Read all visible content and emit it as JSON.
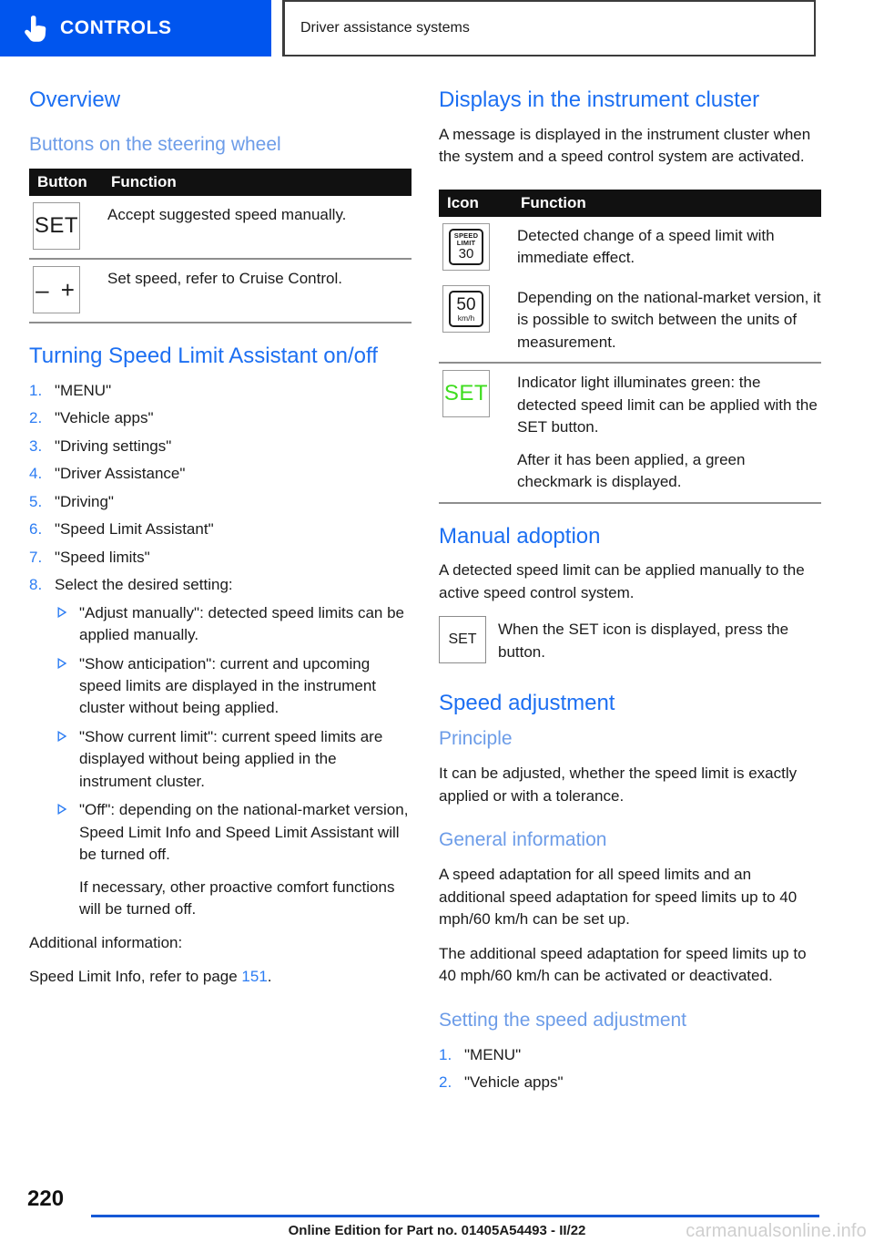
{
  "header": {
    "tab_label": "CONTROLS",
    "hand_icon": "pointing-hand-icon",
    "breadcrumb": "Driver assistance systems",
    "accent_blue": "#0055ee"
  },
  "left": {
    "overview_heading": "Overview",
    "buttons_subheading": "Buttons on the steering wheel",
    "buttons_table": {
      "headers": [
        "Button",
        "Function"
      ],
      "rows": [
        {
          "icon": "SET",
          "icon_kind": "set-button-icon",
          "function": "Accept suggested speed manually."
        },
        {
          "icon": "– +",
          "icon_kind": "minus-plus-rocker-icon",
          "function": "Set speed, refer to Cruise Control."
        }
      ]
    },
    "turning_heading": "Turning Speed Limit Assistant on/off",
    "steps": [
      "\"MENU\"",
      "\"Vehicle apps\"",
      "\"Driving settings\"",
      "\"Driver Assistance\"",
      "\"Driving\"",
      "\"Speed Limit Assistant\"",
      "\"Speed limits\"",
      "Select the desired setting:"
    ],
    "options": [
      {
        "para1": "\"Adjust manually\": detected speed limits can be applied manually."
      },
      {
        "para1": "\"Show anticipation\": current and upcoming speed limits are displayed in the instrument cluster without being applied."
      },
      {
        "para1": "\"Show current limit\": current speed limits are displayed without being applied in the instrument cluster."
      },
      {
        "para1": "\"Off\": depending on the national-market version, Speed Limit Info and Speed Limit Assistant will be turned off.",
        "para2": "If necessary, other proactive comfort functions will be turned off."
      }
    ],
    "additional_label": "Additional information:",
    "xref_prefix": "Speed Limit Info, refer to page ",
    "xref_page": "151",
    "xref_suffix": "."
  },
  "right": {
    "displays_heading": "Displays in the instrument cluster",
    "displays_intro": "A message is displayed in the instrument cluster when the system and a speed control system are activated.",
    "icon_table": {
      "headers": [
        "Icon",
        "Function"
      ],
      "rows": [
        {
          "icon_kind": "speed-limit-30-sign-icon",
          "sign_top": "SPEED",
          "sign_top2": "LIMIT",
          "sign_value": "30",
          "sign_unit": "",
          "function": "Detected change of a speed limit with immediate effect."
        },
        {
          "icon_kind": "speed-limit-50-kmh-sign-icon",
          "sign_top": "",
          "sign_top2": "",
          "sign_value": "50",
          "sign_unit": "km/h",
          "function": "Depending on the national-market version, it is possible to switch between the units of measurement."
        },
        {
          "icon_kind": "set-indicator-green-icon",
          "icon_text": "SET",
          "function": "Indicator light illuminates green: the detected speed limit can be applied with the SET button.",
          "function2": "After it has been applied, a green checkmark is displayed."
        }
      ]
    },
    "manual_heading": "Manual adoption",
    "manual_intro": "A detected speed limit can be applied manually to the active speed control system.",
    "manual_icon_text": "SET",
    "manual_icon_kind": "set-button-icon",
    "manual_icon_note": "When the SET icon is displayed, press the button.",
    "speed_adjust_heading": "Speed adjustment",
    "principle_subheading": "Principle",
    "principle_body": "It can be adjusted, whether the speed limit is exactly applied or with a tolerance.",
    "general_subheading": "General information",
    "general_body_1": "A speed adaptation for all speed limits and an additional speed adaptation for speed limits up to 40 mph/60 km/h can be set up.",
    "general_body_2": "The additional speed adaptation for speed limits up to 40 mph/60 km/h can be activated or deactivated.",
    "setting_subheading": "Setting the speed adjustment",
    "setting_steps": [
      "\"MENU\"",
      "\"Vehicle apps\""
    ]
  },
  "footer": {
    "page_number": "220",
    "edition_text": "Online Edition for Part no. 01405A54493 - II/22",
    "watermark": "carmanualsonline.info",
    "rule_color": "#1558d6"
  }
}
